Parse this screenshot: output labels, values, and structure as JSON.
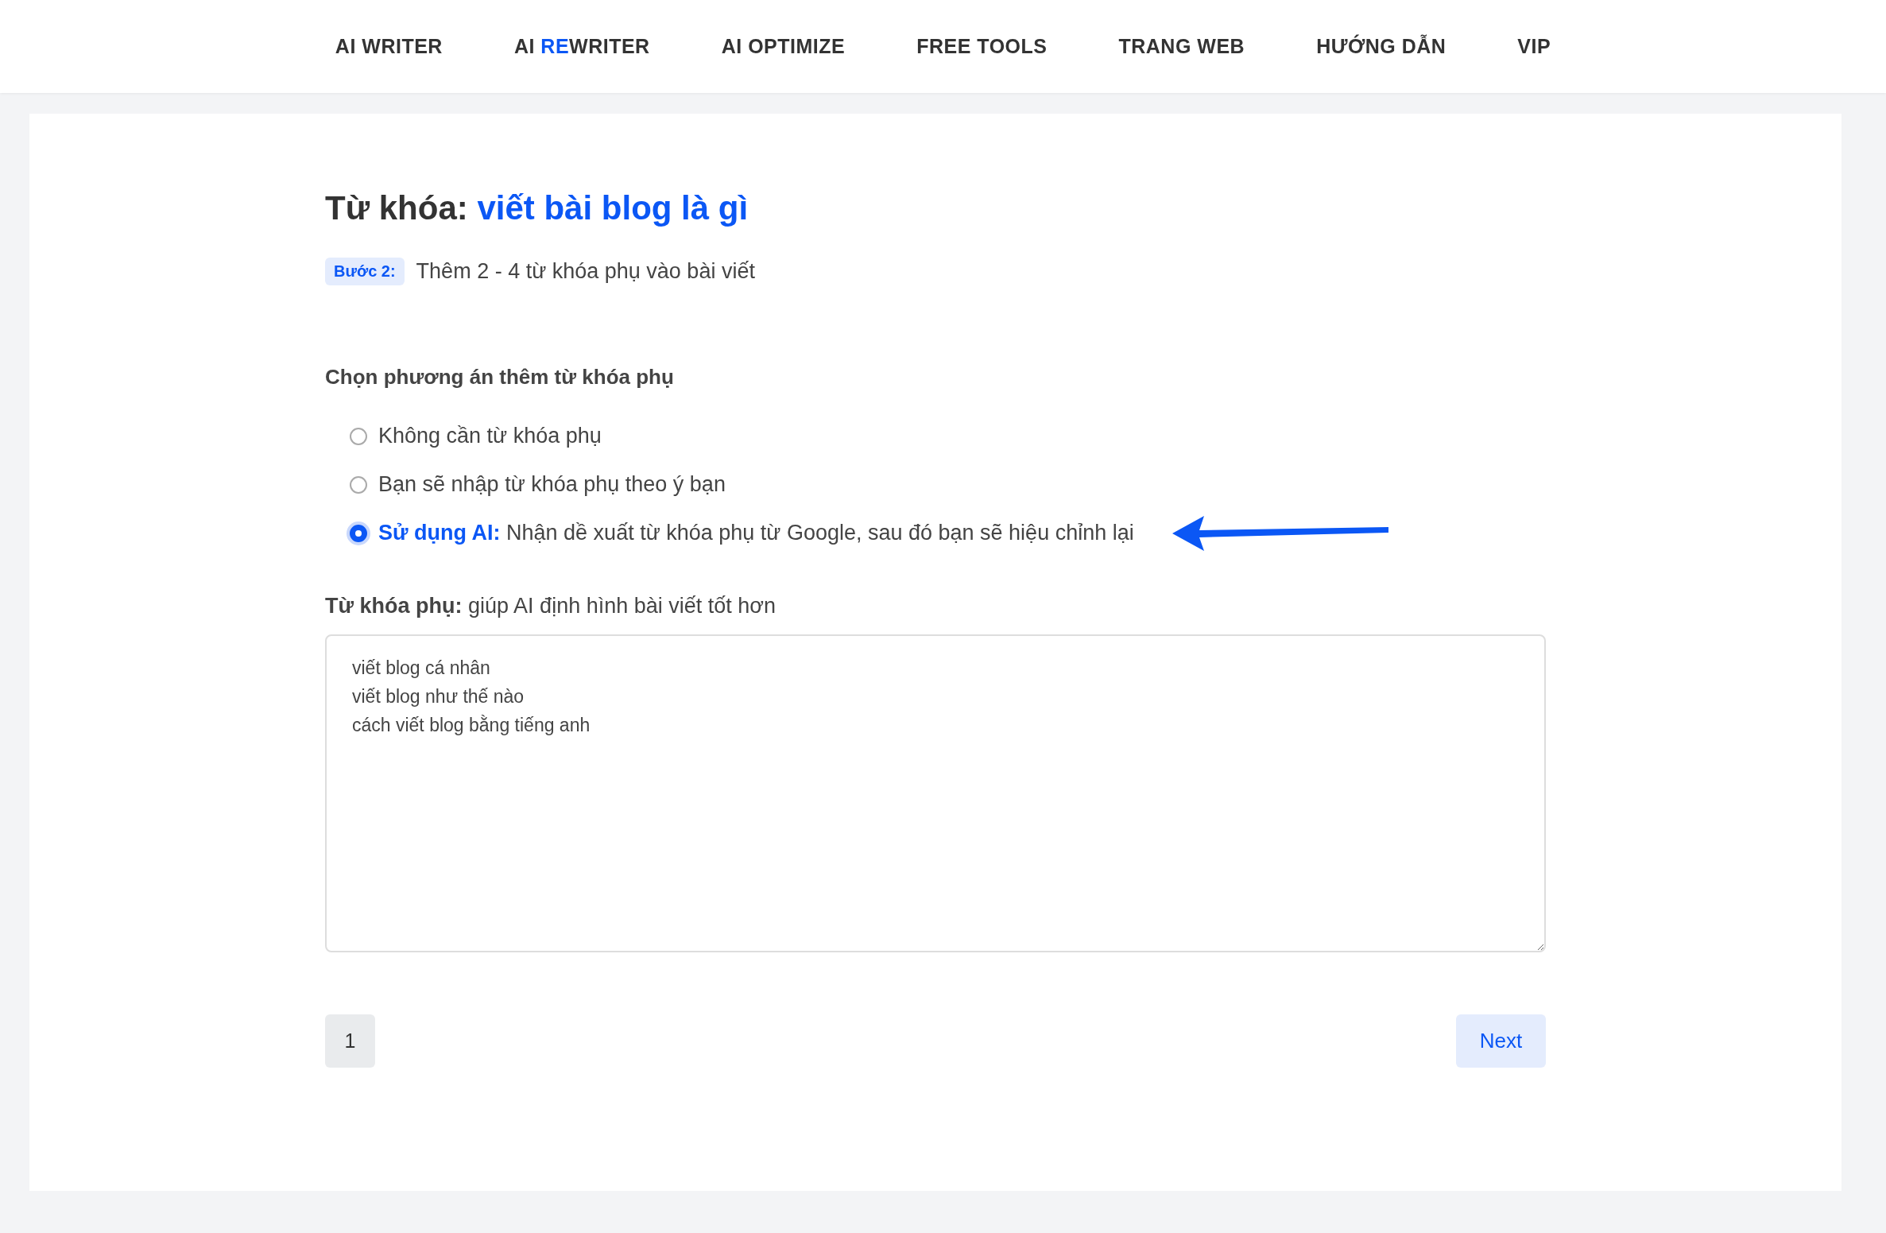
{
  "nav": [
    {
      "parts": [
        {
          "text": "AI WRITER",
          "accent": false
        }
      ]
    },
    {
      "parts": [
        {
          "text": "AI ",
          "accent": false
        },
        {
          "text": "RE",
          "accent": true
        },
        {
          "text": "WRITER",
          "accent": false
        }
      ]
    },
    {
      "parts": [
        {
          "text": "AI OPTIMIZE",
          "accent": false
        }
      ]
    },
    {
      "parts": [
        {
          "text": "FREE TOOLS",
          "accent": false
        }
      ]
    },
    {
      "parts": [
        {
          "text": "TRANG WEB",
          "accent": false
        }
      ]
    },
    {
      "parts": [
        {
          "text": "HƯỚNG DẪN",
          "accent": false
        }
      ]
    },
    {
      "parts": [
        {
          "text": "VIP",
          "accent": false
        }
      ]
    }
  ],
  "heading": {
    "label": "Từ khóa:",
    "keyword": "viết bài blog là gì"
  },
  "step": {
    "badge": "Bước 2:",
    "text": "Thêm 2 - 4 từ khóa phụ vào bài viết"
  },
  "options": {
    "title": "Chọn phương án thêm từ khóa phụ",
    "items": [
      {
        "text": "Không cần từ khóa phụ",
        "selected": false
      },
      {
        "text": "Bạn sẽ nhập từ khóa phụ theo ý bạn",
        "selected": false
      },
      {
        "lead": "Sử dụng AI:",
        "text": "Nhận dề xuất từ khóa phụ từ Google, sau đó bạn sẽ hiệu chỉnh lại",
        "selected": true
      }
    ]
  },
  "secondary": {
    "label": "Từ khóa phụ:",
    "hint": "giúp AI định hình bài viết tốt hơn",
    "lines": [
      "viết blog cá nhân",
      "viết blog như thế nào",
      "cách viết blog bằng tiếng anh"
    ]
  },
  "pager": {
    "page": "1",
    "next": "Next"
  }
}
